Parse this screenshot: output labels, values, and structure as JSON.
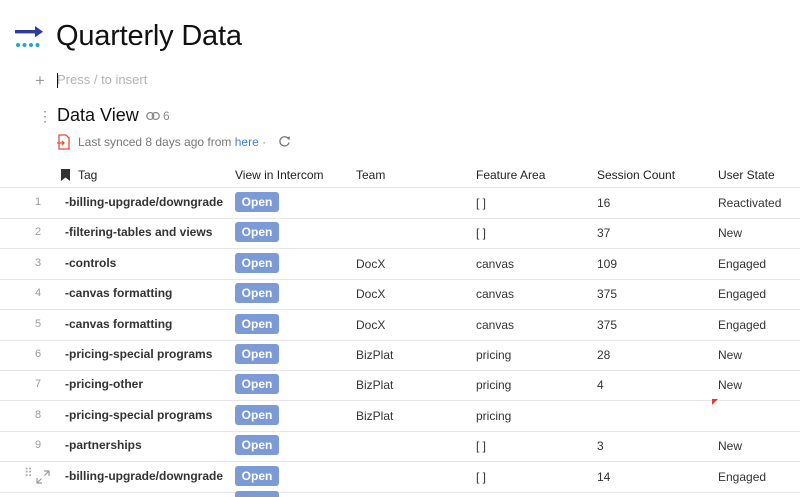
{
  "page": {
    "title": "Quarterly Data",
    "icon": "arrow-dots-icon",
    "insert_placeholder": "Press / to insert"
  },
  "view": {
    "title": "Data View",
    "link_count": "6",
    "sync_prefix": "Last synced 8 days ago from ",
    "sync_link": "here",
    "sync_suffix": " ·"
  },
  "colors": {
    "button": "#7c9ad6",
    "link": "#3f7fd8",
    "flag": "#e53935",
    "icon_primary": "#2f3a9c",
    "icon_secondary": "#25a6c4"
  },
  "table": {
    "columns": [
      "Tag",
      "View in Intercom",
      "Team",
      "Feature Area",
      "Session Count",
      "User State"
    ],
    "button_label": "Open",
    "rows": [
      {
        "num": "1",
        "tag": "-billing-upgrade/downgrade",
        "team": "",
        "area": "[ ]",
        "count": "16",
        "state": "Reactivated"
      },
      {
        "num": "2",
        "tag": "-filtering-tables and views",
        "team": "",
        "area": "[ ]",
        "count": "37",
        "state": "New"
      },
      {
        "num": "3",
        "tag": "-controls",
        "team": "DocX",
        "area": "canvas",
        "count": "109",
        "state": "Engaged"
      },
      {
        "num": "4",
        "tag": "-canvas formatting",
        "team": "DocX",
        "area": "canvas",
        "count": "375",
        "state": "Engaged"
      },
      {
        "num": "5",
        "tag": "-canvas formatting",
        "team": "DocX",
        "area": "canvas",
        "count": "375",
        "state": "Engaged"
      },
      {
        "num": "6",
        "tag": "-pricing-special programs",
        "team": "BizPlat",
        "area": "pricing",
        "count": "28",
        "state": "New"
      },
      {
        "num": "7",
        "tag": "-pricing-other",
        "team": "BizPlat",
        "area": "pricing",
        "count": "4",
        "state": "New"
      },
      {
        "num": "8",
        "tag": "-pricing-special programs",
        "team": "BizPlat",
        "area": "pricing",
        "count": "",
        "state": ""
      },
      {
        "num": "9",
        "tag": "-partnerships",
        "team": "",
        "area": "[ ]",
        "count": "3",
        "state": "New"
      },
      {
        "num": "",
        "tag": "-billing-upgrade/downgrade",
        "team": "",
        "area": "[ ]",
        "count": "14",
        "state": "Engaged"
      }
    ]
  }
}
